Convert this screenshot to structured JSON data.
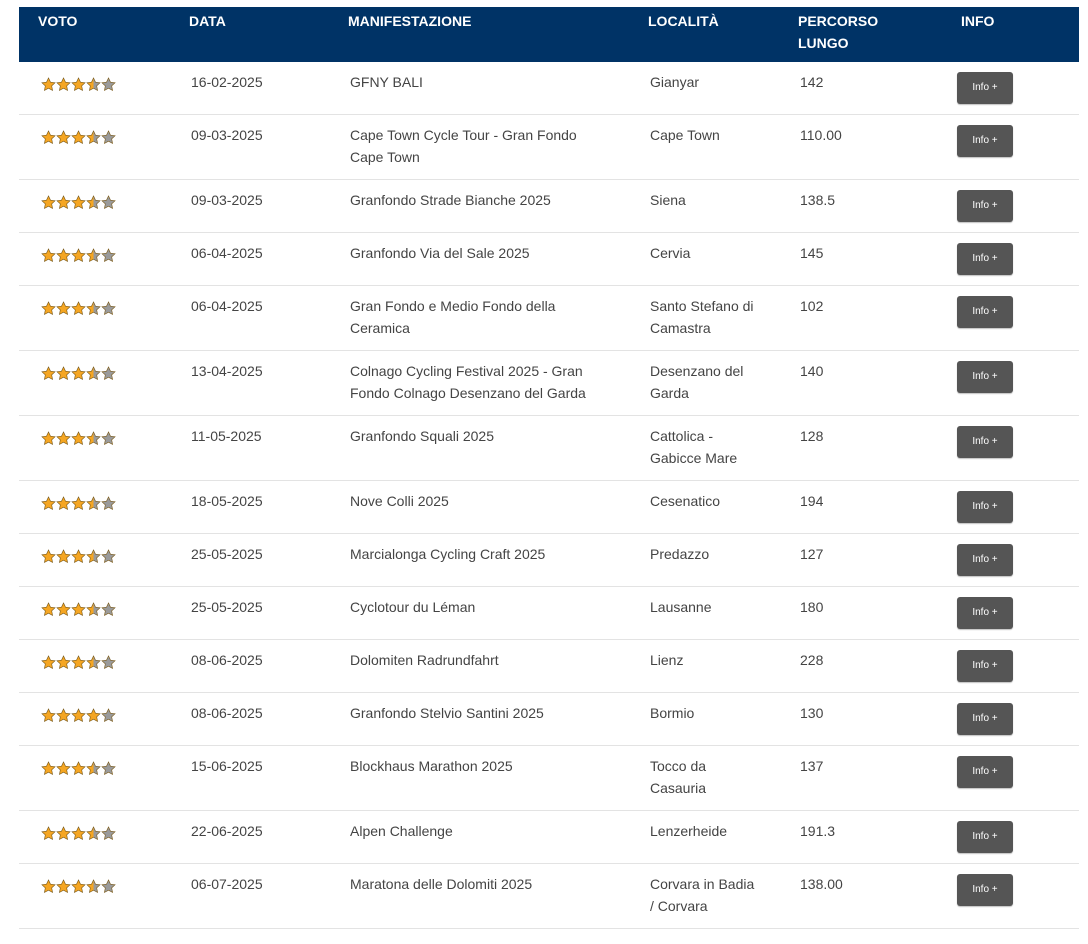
{
  "table": {
    "headers": {
      "voto": "VOTO",
      "data": "DATA",
      "manifestazione": "MANIFESTAZIONE",
      "localita": "LOCALITÀ",
      "percorso_line1": "PERCORSO",
      "percorso_line2": "LUNGO",
      "info": "INFO"
    },
    "rating_scale": 5,
    "colors": {
      "header_bg": "#003366",
      "star_filled": "#f5a623",
      "star_empty": "#9a9a9a",
      "button_bg": "#555555"
    },
    "rows": [
      {
        "rating": 3.5,
        "date": "16-02-2025",
        "event": [
          "GFNY BALI"
        ],
        "location": [
          "Gianyar"
        ],
        "distance": "142",
        "info": "Info +"
      },
      {
        "rating": 3.5,
        "date": "09-03-2025",
        "event": [
          "Cape Town Cycle Tour - Gran Fondo",
          "Cape Town"
        ],
        "location": [
          "Cape Town"
        ],
        "distance": "110.00",
        "info": "Info +"
      },
      {
        "rating": 3.5,
        "date": "09-03-2025",
        "event": [
          "Granfondo Strade Bianche 2025"
        ],
        "location": [
          "Siena"
        ],
        "distance": "138.5",
        "info": "Info +"
      },
      {
        "rating": 3.5,
        "date": "06-04-2025",
        "event": [
          "Granfondo Via del Sale 2025"
        ],
        "location": [
          "Cervia"
        ],
        "distance": "145",
        "info": "Info +"
      },
      {
        "rating": 3.5,
        "date": "06-04-2025",
        "event": [
          "Gran Fondo e Medio Fondo della",
          "Ceramica"
        ],
        "location": [
          "Santo Stefano di",
          "Camastra"
        ],
        "distance": "102",
        "info": "Info +"
      },
      {
        "rating": 3.5,
        "date": "13-04-2025",
        "event": [
          "Colnago Cycling Festival 2025 - Gran",
          "Fondo Colnago Desenzano del Garda"
        ],
        "location": [
          "Desenzano del",
          "Garda"
        ],
        "distance": "140",
        "info": "Info +"
      },
      {
        "rating": 3.5,
        "date": "11-05-2025",
        "event": [
          "Granfondo Squali 2025"
        ],
        "location": [
          "Cattolica -",
          "Gabicce Mare"
        ],
        "distance": "128",
        "info": "Info +"
      },
      {
        "rating": 3.5,
        "date": "18-05-2025",
        "event": [
          "Nove Colli 2025"
        ],
        "location": [
          "Cesenatico"
        ],
        "distance": "194",
        "info": "Info +"
      },
      {
        "rating": 3.5,
        "date": "25-05-2025",
        "event": [
          "Marcialonga Cycling Craft 2025"
        ],
        "location": [
          "Predazzo"
        ],
        "distance": "127",
        "info": "Info +"
      },
      {
        "rating": 3.5,
        "date": "25-05-2025",
        "event": [
          "Cyclotour du Léman"
        ],
        "location": [
          "Lausanne"
        ],
        "distance": "180",
        "info": "Info +"
      },
      {
        "rating": 3.5,
        "date": "08-06-2025",
        "event": [
          "Dolomiten Radrundfahrt"
        ],
        "location": [
          "Lienz"
        ],
        "distance": "228",
        "info": "Info +"
      },
      {
        "rating": 4,
        "date": "08-06-2025",
        "event": [
          "Granfondo Stelvio Santini 2025"
        ],
        "location": [
          "Bormio"
        ],
        "distance": "130",
        "info": "Info +"
      },
      {
        "rating": 3.5,
        "date": "15-06-2025",
        "event": [
          "Blockhaus Marathon 2025"
        ],
        "location": [
          "Tocco da",
          "Casauria"
        ],
        "distance": "137",
        "info": "Info +"
      },
      {
        "rating": 3.5,
        "date": "22-06-2025",
        "event": [
          "Alpen Challenge"
        ],
        "location": [
          "Lenzerheide"
        ],
        "distance": "191.3",
        "info": "Info +"
      },
      {
        "rating": 3.5,
        "date": "06-07-2025",
        "event": [
          "Maratona delle Dolomiti 2025"
        ],
        "location": [
          "Corvara in Badia",
          "/ Corvara"
        ],
        "distance": "138.00",
        "info": "Info +"
      }
    ]
  }
}
